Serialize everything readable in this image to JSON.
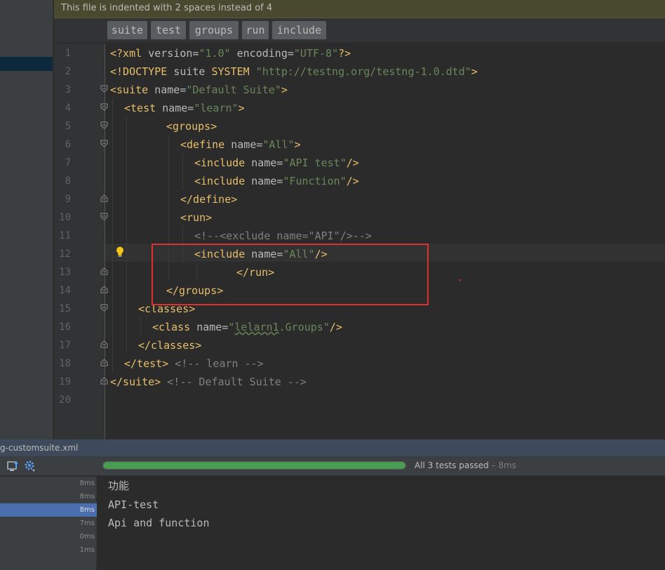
{
  "notification": {
    "text": "This file is indented with 2 spaces instead of 4"
  },
  "breadcrumbs": [
    "suite",
    "test",
    "groups",
    "run",
    "include"
  ],
  "line_numbers": [
    "1",
    "2",
    "3",
    "4",
    "5",
    "6",
    "7",
    "8",
    "9",
    "10",
    "11",
    "12",
    "13",
    "14",
    "15",
    "16",
    "17",
    "18",
    "19",
    "20"
  ],
  "code": {
    "l1": {
      "t1": "<?xml ",
      "a1": "version=",
      "v1": "\"1.0\"",
      "a2": " encoding=",
      "v2": "\"UTF-8\"",
      "t2": "?>"
    },
    "l2": {
      "t1": "<!DOCTYPE ",
      "a1": "suite ",
      "d1": "SYSTEM ",
      "v1": "\"http://testng.org/testng-1.0.dtd\"",
      "t2": ">"
    },
    "l3": {
      "t1": "<suite ",
      "a1": "name=",
      "v1": "\"Default Suite\"",
      "t2": ">"
    },
    "l4": {
      "t1": "<test ",
      "a1": "name=",
      "v1": "\"learn\"",
      "t2": ">"
    },
    "l5": {
      "t1": "<groups>"
    },
    "l6": {
      "t1": "<define ",
      "a1": "name=",
      "v1": "\"All\"",
      "t2": ">"
    },
    "l7": {
      "t1": "<include ",
      "a1": "name=",
      "v1": "\"API test\"",
      "t2": "/>"
    },
    "l8": {
      "t1": "<include ",
      "a1": "name=",
      "v1": "\"Function\"",
      "t2": "/>"
    },
    "l9": {
      "t1": "</define>"
    },
    "l10": {
      "t1": "<run>"
    },
    "l11": {
      "c1": "<!--<exclude name=\"API\"/>-->"
    },
    "l12": {
      "t1": "<include ",
      "a1": "name=",
      "v1": "\"All\"",
      "t2": "/>"
    },
    "l13": {
      "t1": "</run>"
    },
    "l14": {
      "t1": "</groups>"
    },
    "l15": {
      "t1": "<classes>"
    },
    "l16": {
      "t1": "<class ",
      "a1": "name=",
      "v1a": "\"",
      "v1b": "lelarn1",
      "v1c": ".Groups\"",
      "t2": "/>"
    },
    "l17": {
      "t1": "</classes>"
    },
    "l18": {
      "t1": "</test>",
      "c1": " <!-- learn -->"
    },
    "l19": {
      "t1": "</suite>",
      "c1": " <!-- Default Suite -->"
    }
  },
  "run_panel": {
    "title": "g-customsuite.xml",
    "status": "All 3 tests passed",
    "duration": " – 8ms",
    "progress": 1.0,
    "test_times": [
      "8ms",
      "8ms",
      "8ms",
      "7ms",
      "0ms",
      "1ms"
    ],
    "selected_index": 2,
    "console_lines": [
      "功能",
      "API-test",
      "Api and function"
    ]
  },
  "colors": {
    "tag": "#e8bf6a",
    "attribute": "#bababa",
    "value": "#6a8759",
    "comment": "#808080",
    "highlight_box": "#e0312f",
    "progress": "#499c54"
  },
  "icons": [
    "fold-marker-icon",
    "lightbulb-icon",
    "export-icon",
    "settings-icon"
  ]
}
